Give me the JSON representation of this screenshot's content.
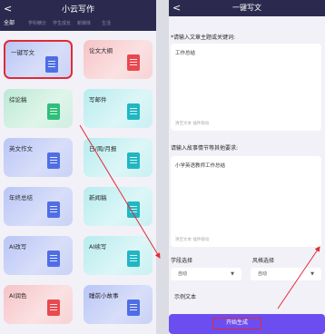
{
  "left_screen": {
    "back": "<",
    "title": "小云写作",
    "tabs": [
      "全部",
      "学科精分",
      "学生成长",
      "新媒体",
      "生活"
    ],
    "cards": [
      {
        "label": "一键写文",
        "color": "blue",
        "selected": true
      },
      {
        "label": "论文大纲",
        "color": "red",
        "selected": false
      },
      {
        "label": "综论稿",
        "color": "green",
        "selected": false
      },
      {
        "label": "写邮件",
        "color": "teal",
        "selected": false
      },
      {
        "label": "英文作文",
        "color": "blue",
        "selected": false
      },
      {
        "label": "日/周/月报",
        "color": "teal",
        "selected": false
      },
      {
        "label": "年终总结",
        "color": "blue",
        "selected": false
      },
      {
        "label": "新闻稿",
        "color": "teal",
        "selected": false
      },
      {
        "label": "AI改写",
        "color": "blue",
        "selected": false
      },
      {
        "label": "AI续写",
        "color": "teal",
        "selected": false
      },
      {
        "label": "AI润色",
        "color": "red",
        "selected": false
      },
      {
        "label": "睡前小故事",
        "color": "blue",
        "selected": false
      }
    ]
  },
  "right_screen": {
    "back": "<",
    "title": "一键写文",
    "topic_label": "*请输入文章主题或关键词:",
    "topic_value": "工作总结",
    "topic_hint": "清空文本  插件联动",
    "req_label": "请输入故事情节等其他要求:",
    "req_value": "小学英语教师工作总结",
    "req_hint": "清空文本  插件联动",
    "school_label": "学段选择",
    "school_value": "自动",
    "style_label": "风格选择",
    "style_value": "自动",
    "example_label": "示例文本",
    "generate_button": "开始生成"
  },
  "colors": {
    "header_bg": "#2b2a4e",
    "panel_bg": "#f2f1f7",
    "accent_purple": "#6c4ef0",
    "highlight_red": "#e22a36"
  }
}
